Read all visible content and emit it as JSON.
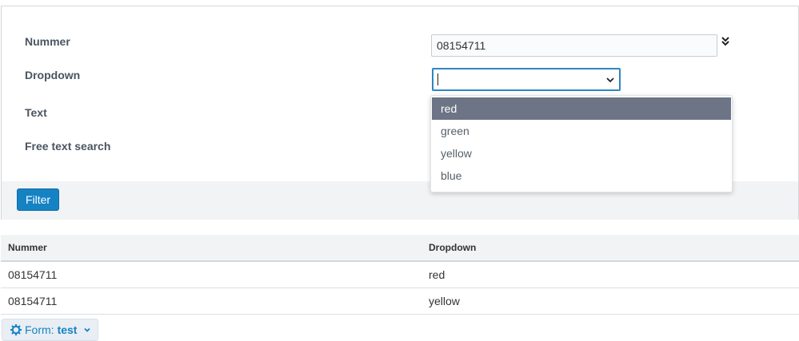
{
  "filter": {
    "fields": {
      "nummer_label": "Nummer",
      "dropdown_label": "Dropdown",
      "text_label": "Text",
      "free_text_label": "Free text search"
    },
    "nummer_value": "08154711",
    "dropdown_value": "",
    "dropdown_options": [
      "red",
      "green",
      "yellow",
      "blue"
    ],
    "dropdown_highlighted": "red",
    "filter_button_label": "Filter"
  },
  "table": {
    "headers": [
      "Nummer",
      "Dropdown"
    ],
    "rows": [
      [
        "08154711",
        "red"
      ],
      [
        "08154711",
        "yellow"
      ]
    ]
  },
  "form_menu": {
    "prefix": "Form:",
    "name": "test"
  },
  "icons": {
    "collapse": "double-chevron-down-icon",
    "select_chevron": "chevron-down-icon",
    "form_gear": "gear-icon",
    "form_chevron": "chevron-down-icon"
  },
  "colors": {
    "accent": "#1582c4",
    "focus_border": "#2e86c1",
    "option_highlight": "#6c7486"
  }
}
